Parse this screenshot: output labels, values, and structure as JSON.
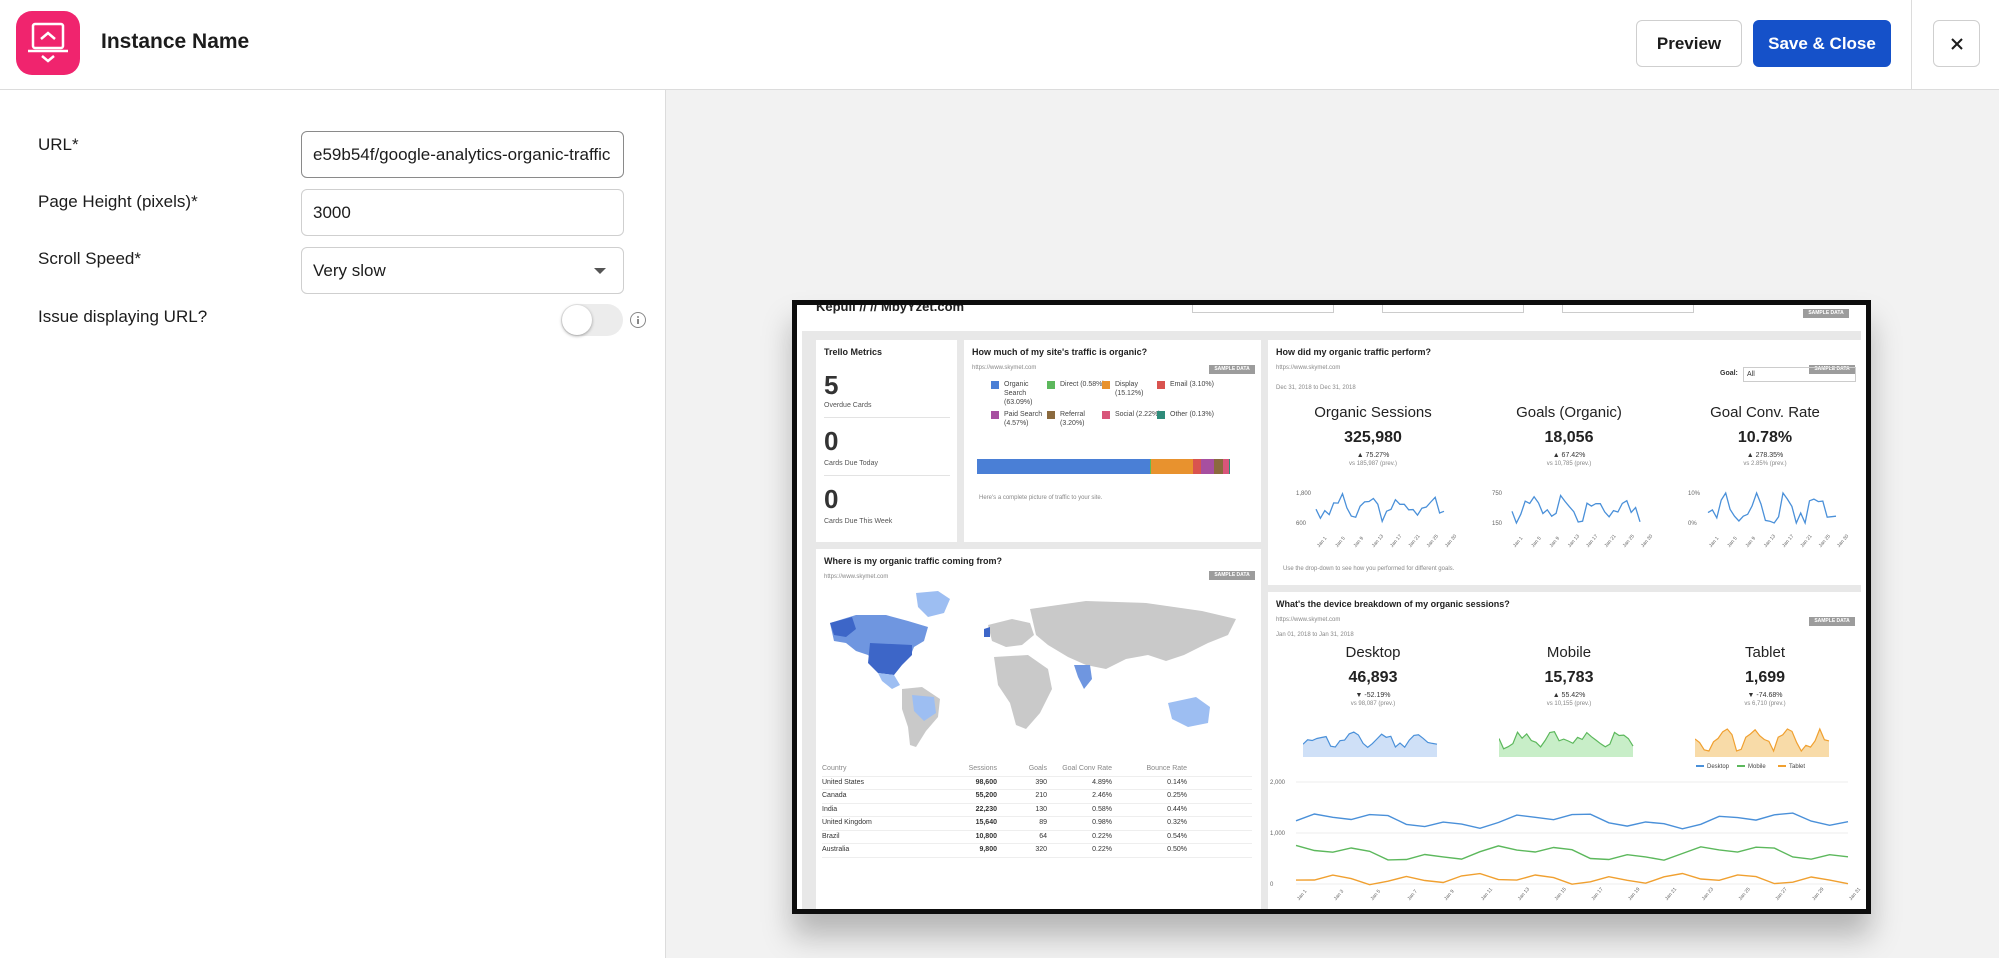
{
  "header": {
    "title": "Instance Name",
    "preview_label": "Preview",
    "save_label": "Save & Close"
  },
  "form": {
    "url_label": "URL*",
    "url_value": "e59b54f/google-analytics-organic-traffic",
    "height_label": "Page Height (pixels)*",
    "height_value": "3000",
    "speed_label": "Scroll Speed*",
    "speed_value": "Very slow",
    "issue_label": "Issue displaying URL?",
    "issue_enabled": false
  },
  "colors": {
    "brand_pink": "#f0246e",
    "primary_blue": "#1551c9",
    "chart_blue": "#4a90d9",
    "chart_green": "#5cb85c",
    "chart_orange": "#f0a030"
  },
  "preview": {
    "top_header": "Kepuli // //  MbyYzet.com",
    "sample_badge": "SAMPLE DATA",
    "trello": {
      "title": "Trello Metrics",
      "items": [
        {
          "value": "5",
          "label": "Overdue Cards"
        },
        {
          "value": "0",
          "label": "Cards Due Today"
        },
        {
          "value": "0",
          "label": "Cards Due This Week"
        }
      ]
    },
    "organic_share": {
      "title": "How much of my site's traffic is organic?",
      "url": "https://www.skymet.com",
      "legend": [
        {
          "name": "Organic Search",
          "pct": "(63.09%)",
          "color": "#4a7fd6"
        },
        {
          "name": "Direct",
          "pct": "(0.58%)",
          "color": "#5cb85c"
        },
        {
          "name": "Display",
          "pct": "(15.12%)",
          "color": "#e8922e"
        },
        {
          "name": "Email",
          "pct": "(3.10%)",
          "color": "#d9534f"
        },
        {
          "name": "Paid Search",
          "pct": "(4.57%)",
          "color": "#a74fa0"
        },
        {
          "name": "Referral",
          "pct": "(3.20%)",
          "color": "#8b6a3e"
        },
        {
          "name": "Social",
          "pct": "(2.22%)",
          "color": "#d8557a"
        },
        {
          "name": "Other",
          "pct": "(0.13%)",
          "color": "#2e8b7a"
        }
      ],
      "note": "Here's a complete picture of traffic to your site."
    },
    "organic_perf": {
      "title": "How did my organic traffic perform?",
      "url": "https://www.skymet.com",
      "date_range": "Dec 31, 2018 to Dec 31, 2018",
      "goal_label": "Goal:",
      "goal_value": "All",
      "note": "Use the drop-down to see how you performed for different goals.",
      "kpis": [
        {
          "title": "Organic Sessions",
          "value": "325,980",
          "change": "▲ 75.27%",
          "prev": "vs 185,987 (prev.)",
          "y_hi": "1,800",
          "y_lo": "600"
        },
        {
          "title": "Goals (Organic)",
          "value": "18,056",
          "change": "▲ 67.42%",
          "prev": "vs 10,785 (prev.)",
          "y_hi": "750",
          "y_lo": "150"
        },
        {
          "title": "Goal Conv. Rate",
          "value": "10.78%",
          "change": "▲ 278.35%",
          "prev": "vs 2.85% (prev.)",
          "y_hi": "10%",
          "y_lo": "0%"
        }
      ],
      "x_ticks": [
        "Jan 1",
        "Jan 5",
        "Jan 9",
        "Jan 13",
        "Jan 17",
        "Jan 21",
        "Jan 25",
        "Jan 30"
      ]
    },
    "geo": {
      "title": "Where is my organic traffic coming from?",
      "url": "https://www.skymet.com",
      "columns": [
        "Country",
        "Sessions",
        "Goals",
        "Goal Conv Rate",
        "Bounce Rate"
      ],
      "rows": [
        [
          "United States",
          "98,600",
          "390",
          "4.89%",
          "0.14%"
        ],
        [
          "Canada",
          "55,200",
          "210",
          "2.46%",
          "0.25%"
        ],
        [
          "India",
          "22,230",
          "130",
          "0.58%",
          "0.44%"
        ],
        [
          "United Kingdom",
          "15,640",
          "89",
          "0.98%",
          "0.32%"
        ],
        [
          "Brazil",
          "10,800",
          "64",
          "0.22%",
          "0.54%"
        ],
        [
          "Australia",
          "9,800",
          "320",
          "0.22%",
          "0.50%"
        ]
      ]
    },
    "devices": {
      "title": "What's the device breakdown of my organic sessions?",
      "url": "https://www.skymet.com",
      "date_range": "Jan 01, 2018 to Jan 31, 2018",
      "kpis": [
        {
          "title": "Desktop",
          "value": "46,893",
          "change": "▼ -52.19%",
          "prev": "vs 98,087 (prev.)"
        },
        {
          "title": "Mobile",
          "value": "15,783",
          "change": "▲ 55.42%",
          "prev": "vs 10,155 (prev.)"
        },
        {
          "title": "Tablet",
          "value": "1,699",
          "change": "▼ -74.68%",
          "prev": "vs 6,710 (prev.)"
        }
      ],
      "legend": [
        "Desktop",
        "Mobile",
        "Tablet"
      ],
      "y_ticks": [
        "2,000",
        "1,000",
        "0"
      ],
      "x_ticks": [
        "Jan 1",
        "Jan 3",
        "Jan 5",
        "Jan 7",
        "Jan 9",
        "Jan 11",
        "Jan 13",
        "Jan 15",
        "Jan 17",
        "Jan 19",
        "Jan 21",
        "Jan 23",
        "Jan 25",
        "Jan 27",
        "Jan 29",
        "Jan 31"
      ]
    }
  }
}
